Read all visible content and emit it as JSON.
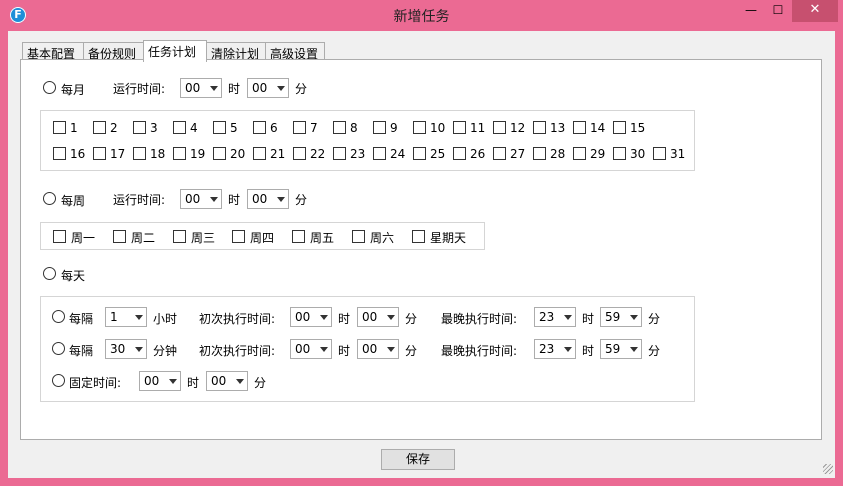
{
  "window": {
    "title": "新增任务",
    "icon_letter": "F",
    "controls": {
      "minimize": "—",
      "maximize": "☐",
      "close": "✕"
    }
  },
  "tabs": [
    {
      "label": "基本配置",
      "active": false
    },
    {
      "label": "备份规则",
      "active": false
    },
    {
      "label": "任务计划",
      "active": true
    },
    {
      "label": "清除计划",
      "active": false
    },
    {
      "label": "高级设置",
      "active": false
    }
  ],
  "monthly": {
    "radio_label": "每月",
    "run_time_label": "运行时间:",
    "hour_value": "00",
    "hour_unit": "时",
    "minute_value": "00",
    "minute_unit": "分",
    "days": [
      "1",
      "2",
      "3",
      "4",
      "5",
      "6",
      "7",
      "8",
      "9",
      "10",
      "11",
      "12",
      "13",
      "14",
      "15",
      "16",
      "17",
      "18",
      "19",
      "20",
      "21",
      "22",
      "23",
      "24",
      "25",
      "26",
      "27",
      "28",
      "29",
      "30",
      "31"
    ]
  },
  "weekly": {
    "radio_label": "每周",
    "run_time_label": "运行时间:",
    "hour_value": "00",
    "hour_unit": "时",
    "minute_value": "00",
    "minute_unit": "分",
    "days": [
      "周一",
      "周二",
      "周三",
      "周四",
      "周五",
      "周六",
      "星期天"
    ]
  },
  "daily": {
    "radio_label": "每天",
    "every_hours": {
      "radio_label": "每隔",
      "value": "1",
      "unit": "小时",
      "first_label": "初次执行时间:",
      "first_hour": "00",
      "first_minute": "00",
      "last_label": "最晚执行时间:",
      "last_hour": "23",
      "last_minute": "59",
      "hour_unit": "时",
      "minute_unit": "分"
    },
    "every_minutes": {
      "radio_label": "每隔",
      "value": "30",
      "unit": "分钟",
      "first_label": "初次执行时间:",
      "first_hour": "00",
      "first_minute": "00",
      "last_label": "最晚执行时间:",
      "last_hour": "23",
      "last_minute": "59",
      "hour_unit": "时",
      "minute_unit": "分"
    },
    "fixed": {
      "radio_label": "固定时间:",
      "hour": "00",
      "hour_unit": "时",
      "minute": "00",
      "minute_unit": "分"
    }
  },
  "footer": {
    "save_label": "保存"
  }
}
